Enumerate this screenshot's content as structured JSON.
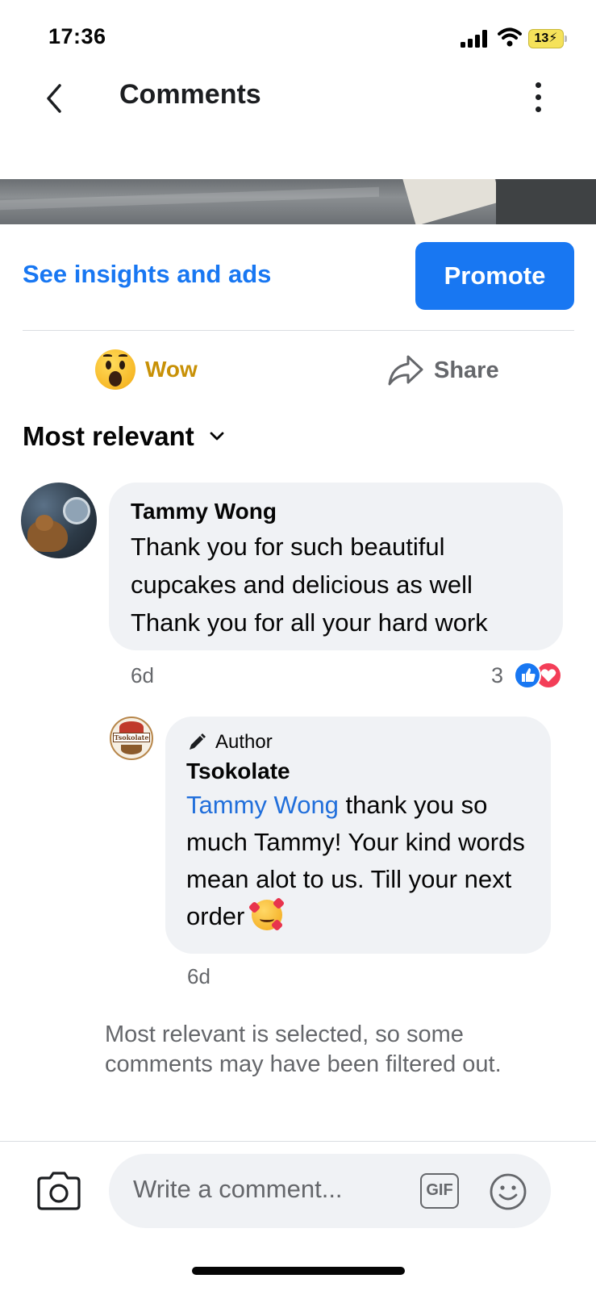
{
  "status_bar": {
    "time": "17:36",
    "battery": "13"
  },
  "header": {
    "title": "Comments"
  },
  "post": {
    "insights_label": "See insights and ads",
    "promote_label": "Promote"
  },
  "actions": {
    "reaction_label": "Wow",
    "share_label": "Share"
  },
  "sort": {
    "label": "Most relevant"
  },
  "comments": [
    {
      "author": "Tammy Wong",
      "text": "Thank you for such beautiful cupcakes and delicious as well Thank you for all your hard work",
      "time": "6d",
      "reaction_count": "3",
      "reactions": [
        "like",
        "love"
      ]
    }
  ],
  "reply": {
    "badge": "Author",
    "author": "Tsokolate",
    "mention": "Tammy Wong",
    "text": " thank you so much Tammy! Your kind words mean alot to  us. Till your next order ",
    "emoji": "smiling-face-with-hearts",
    "time": "6d",
    "avatar_text": "Tsokolate"
  },
  "filter_note": "Most relevant is selected, so some comments may have been filtered out.",
  "composer": {
    "placeholder": "Write a comment...",
    "gif_label": "GIF"
  },
  "colors": {
    "accent": "#1877f2",
    "bubble": "#f0f2f5",
    "muted": "#65676b",
    "wow": "#c89107"
  }
}
